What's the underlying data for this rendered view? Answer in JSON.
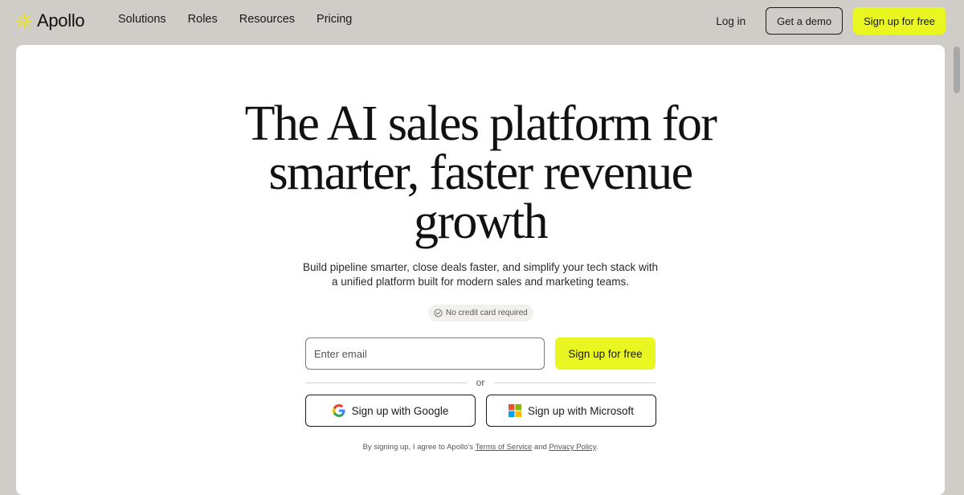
{
  "nav": {
    "logo_text": "Apollo",
    "logo_icon": "apollo-burst-icon",
    "links": [
      "Solutions",
      "Roles",
      "Resources",
      "Pricing"
    ],
    "login": "Log in",
    "demo": "Get a demo",
    "signup": "Sign up for free"
  },
  "hero": {
    "headline_lines": [
      "The AI sales platform for",
      "smarter, faster revenue",
      "growth"
    ],
    "subtitle_lines": [
      "Build pipeline smarter, close deals faster, and simplify your tech stack with",
      "a unified platform built for modern sales and marketing teams."
    ],
    "badge": "No credit card required",
    "badge_icon": "check-circle-icon"
  },
  "form": {
    "email_placeholder": "Enter email",
    "signup_button": "Sign up for free",
    "divider_text": "or",
    "google_button": "Sign up with Google",
    "microsoft_button": "Sign up with Microsoft"
  },
  "legal": {
    "prefix": "By signing up, I agree to Apollo's ",
    "terms": "Terms of Service",
    "joiner": " and ",
    "privacy": "Privacy Policy",
    "suffix": "."
  },
  "colors": {
    "accent_yellow": "#eaf61f",
    "page_bg": "#d0cdc8",
    "card_bg": "#ffffff"
  }
}
